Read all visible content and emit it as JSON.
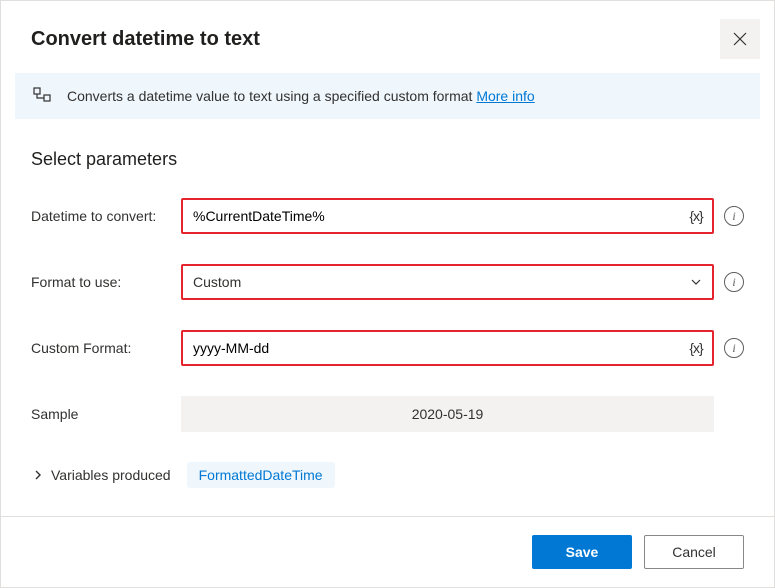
{
  "dialog": {
    "title": "Convert datetime to text"
  },
  "banner": {
    "text": "Converts a datetime value to text using a specified custom format ",
    "more_info": "More info"
  },
  "section": {
    "title": "Select parameters"
  },
  "fields": {
    "datetime_label": "Datetime to convert:",
    "datetime_value": "%CurrentDateTime%",
    "format_label": "Format to use:",
    "format_value": "Custom",
    "custom_label": "Custom Format:",
    "custom_value": "yyyy-MM-dd",
    "sample_label": "Sample",
    "sample_value": "2020-05-19",
    "var_token": "{x}"
  },
  "variables": {
    "label": "Variables produced",
    "pill": "FormattedDateTime"
  },
  "footer": {
    "save": "Save",
    "cancel": "Cancel"
  }
}
